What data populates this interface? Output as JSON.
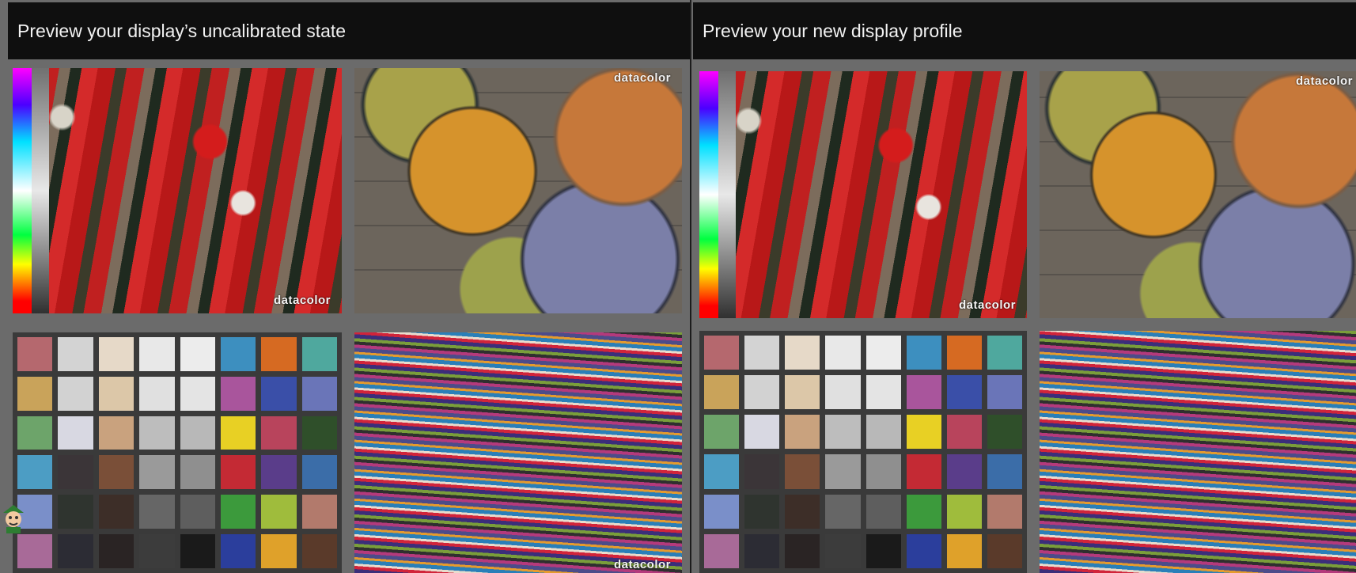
{
  "left_panel": {
    "title": "Preview your display’s uncalibrated state"
  },
  "right_panel": {
    "title": "Preview your new display profile"
  },
  "watermark": "datacolor",
  "checker_colors": [
    "#b5686e",
    "#d3d3d3",
    "#e6d9c8",
    "#e8e8e8",
    "#ececec",
    "#3d8fbf",
    "#d66a22",
    "#4fa89e",
    "#c9a35a",
    "#d2d2d2",
    "#dcc7a8",
    "#e0e0e0",
    "#e4e4e4",
    "#a9559c",
    "#3a4fa8",
    "#6a75b8",
    "#6da46a",
    "#d8d8e2",
    "#c9a27e",
    "#bdbdbd",
    "#b8b8b8",
    "#e8d024",
    "#b8445c",
    "#2f4f2a",
    "#4c9dc4",
    "#3b3538",
    "#7a4f38",
    "#9a9a9a",
    "#8f8f8f",
    "#c42a34",
    "#5a3d8a",
    "#3b6da8",
    "#7a8fc9",
    "#2f342f",
    "#3d2e28",
    "#666666",
    "#5e5e5e",
    "#3c9a3c",
    "#9fbc3c",
    "#b27a6c",
    "#a86a98",
    "#2c2c34",
    "#2a2424",
    "#3c3c3c",
    "#1a1a1a",
    "#2b3e9c",
    "#dfa12a",
    "#5a3a2a"
  ]
}
